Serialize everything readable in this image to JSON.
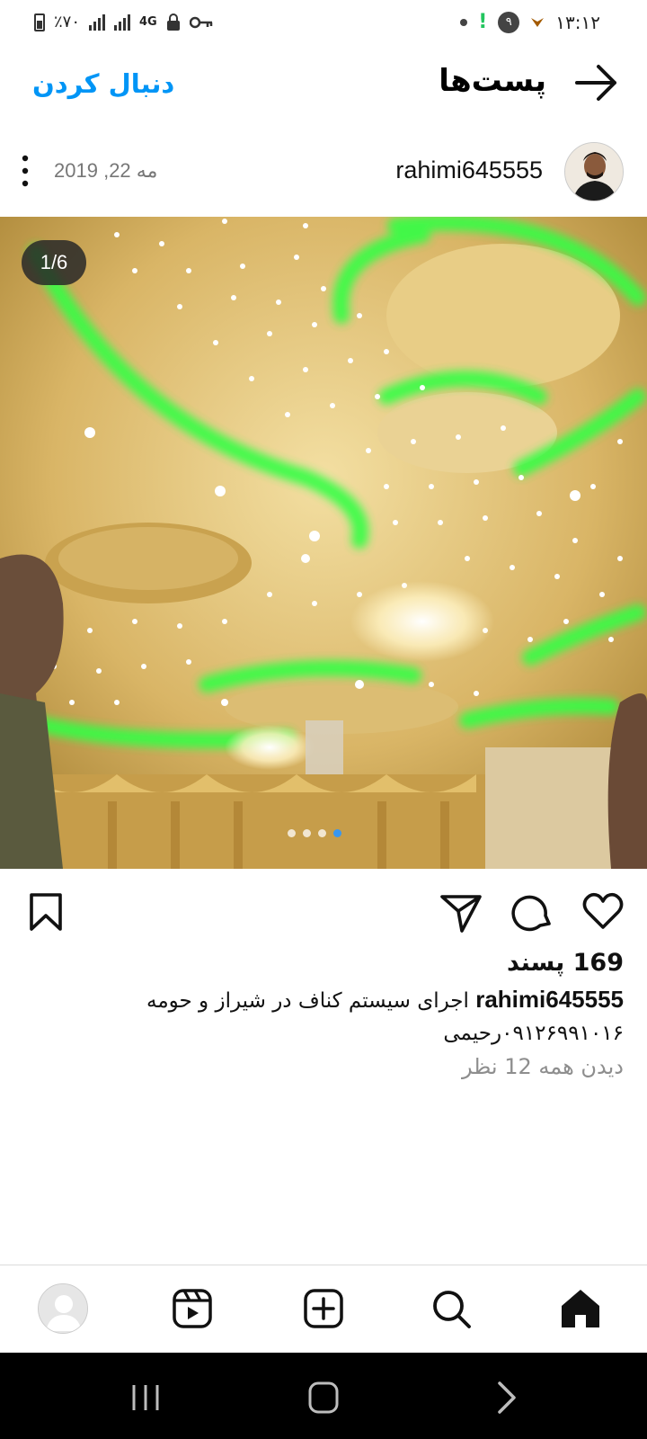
{
  "status_bar": {
    "battery_text": "٪۷۰",
    "network": "4G",
    "time": "۱۳:۱۲",
    "notification_count": "۹"
  },
  "header": {
    "title": "پست‌ها",
    "follow_label": "دنبال کردن"
  },
  "post": {
    "username": "rahimi645555",
    "date": "مه 22, 2019",
    "image_counter": "1/6",
    "carousel": {
      "count": 4,
      "active_index": 3
    },
    "likes": "169 پسند",
    "caption_username": "rahimi645555",
    "caption_text": "اجرای سیستم کناف در شیراز و حومه",
    "caption_line2": "۰۹۱۲۶۹۹۱۰۱۶رحیمی",
    "view_comments": "دیدن همه 12 نظر"
  },
  "colors": {
    "accent": "#0095f6",
    "ceiling_gold": "#d9b566",
    "led_green": "#33ff44"
  },
  "icons": {
    "like": "heart-icon",
    "comment": "comment-icon",
    "share": "send-icon",
    "save": "bookmark-icon",
    "back": "arrow-right-icon",
    "more": "more-vertical-icon"
  },
  "bottom_nav": [
    "home-icon",
    "search-icon",
    "add-post-icon",
    "reels-icon",
    "profile-avatar"
  ]
}
